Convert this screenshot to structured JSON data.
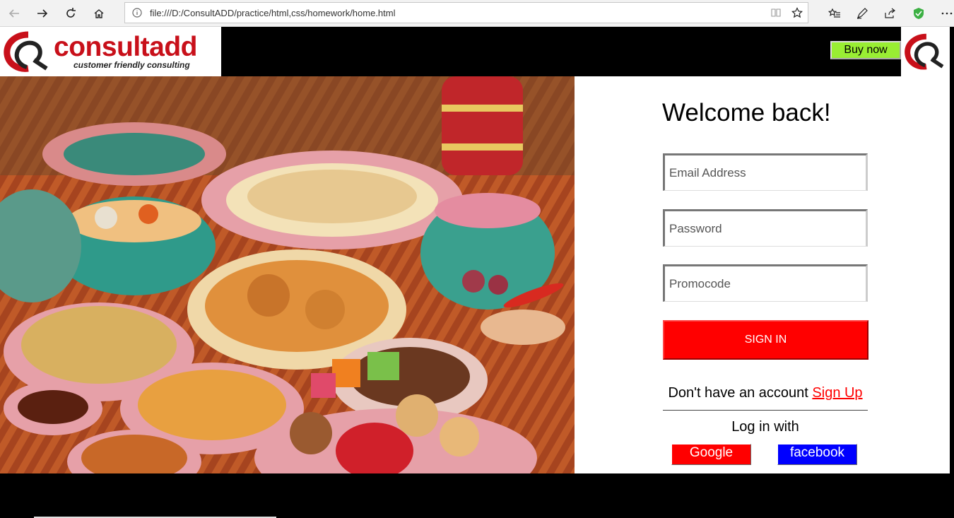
{
  "browser": {
    "url": "file:///D:/ConsultADD/practice/html,css/homework/home.html"
  },
  "header": {
    "brand": "consultadd",
    "tagline": "customer friendly consulting",
    "buy_label": "Buy now"
  },
  "login": {
    "title": "Welcome back!",
    "email_placeholder": "Email Address",
    "password_placeholder": "Password",
    "promo_placeholder": "Promocode",
    "signin_label": "SIGN IN",
    "no_account_text": "Don't have an account",
    "signup_label": "Sign Up",
    "login_with_text": "Log in with",
    "google_label": "Google",
    "facebook_label": "facebook"
  },
  "colors": {
    "brand_red": "#c8101a",
    "buy_green": "#99ee33",
    "signin_red": "#ff0000",
    "facebook_blue": "#0000ff"
  }
}
